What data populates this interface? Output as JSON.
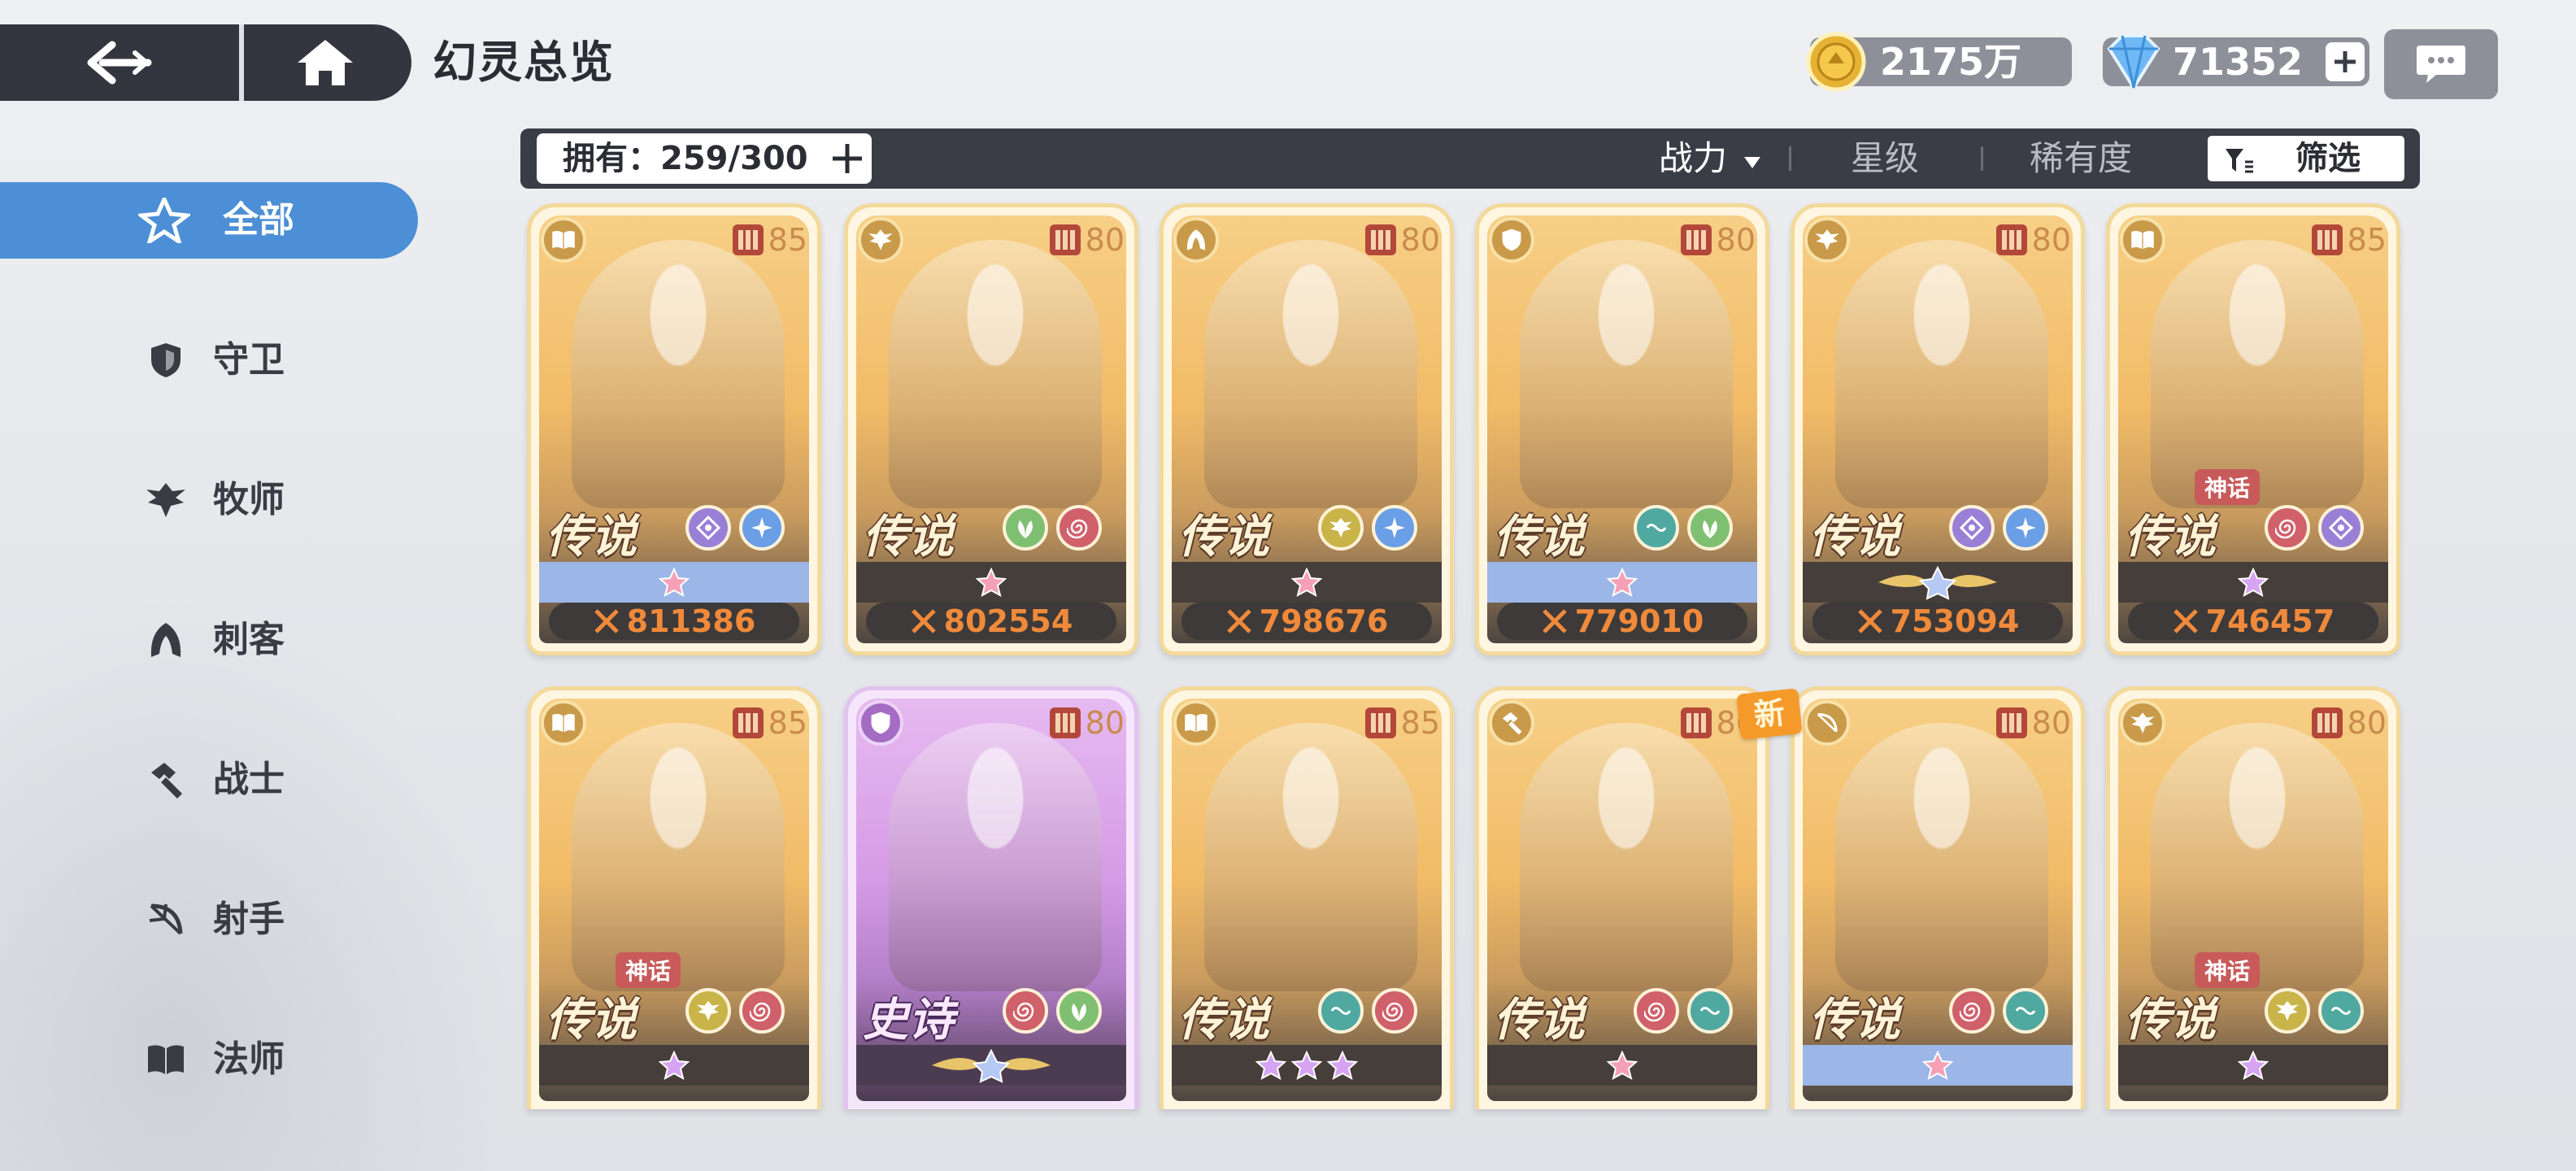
{
  "header": {
    "title": "幻灵总览"
  },
  "currency": {
    "gold": "2175万",
    "gems": "71352"
  },
  "sidebar": {
    "items": [
      {
        "label": "全部",
        "icon": "all-star-icon",
        "active": true
      },
      {
        "label": "守卫",
        "icon": "shield-icon"
      },
      {
        "label": "牧师",
        "icon": "wing-icon"
      },
      {
        "label": "刺客",
        "icon": "assassin-icon"
      },
      {
        "label": "战士",
        "icon": "hammer-icon"
      },
      {
        "label": "射手",
        "icon": "bow-icon"
      },
      {
        "label": "法师",
        "icon": "book-icon"
      }
    ]
  },
  "filter_bar": {
    "owned": "拥有：259/300",
    "sort_power": "战力",
    "sort_star": "星级",
    "sort_rarity": "稀有度",
    "filter": "筛选"
  },
  "cards": [
    {
      "level": "85",
      "rarity": "传说",
      "power": "811386",
      "stars": 1,
      "strip": "blue"
    },
    {
      "level": "80",
      "rarity": "传说",
      "power": "802554",
      "stars": 1,
      "strip": "dark"
    },
    {
      "level": "80",
      "rarity": "传说",
      "power": "798676",
      "stars": 1,
      "strip": "dark"
    },
    {
      "level": "80",
      "rarity": "传说",
      "power": "779010",
      "stars": 1,
      "strip": "blue"
    },
    {
      "level": "80",
      "rarity": "传说",
      "power": "753094",
      "stars": 0,
      "strip": "dark"
    },
    {
      "level": "85",
      "rarity": "传说",
      "myth": "神话",
      "power": "746457",
      "stars": 1,
      "strip": "dark"
    },
    {
      "level": "85",
      "rarity": "传说",
      "myth": "神话",
      "stars": 1,
      "strip": "dark"
    },
    {
      "level": "80",
      "rarity": "史诗",
      "stars": 0,
      "strip": "dark"
    },
    {
      "level": "85",
      "rarity": "传说",
      "stars": 3,
      "strip": "dark"
    },
    {
      "level": "86",
      "rarity": "传说",
      "stars": 1,
      "strip": "dark"
    },
    {
      "level": "80",
      "rarity": "传说",
      "stars": 1,
      "strip": "blue"
    },
    {
      "level": "80",
      "rarity": "传说",
      "myth": "神话",
      "stars": 1,
      "strip": "dark"
    }
  ],
  "new_badge": "新",
  "colors": {
    "accent_blue": "#4c8fd6",
    "panel_dark": "#3a3c46",
    "power_orange": "#f08a3a",
    "legend_gold": "#f1bb67",
    "epic_purple": "#d59be6"
  }
}
